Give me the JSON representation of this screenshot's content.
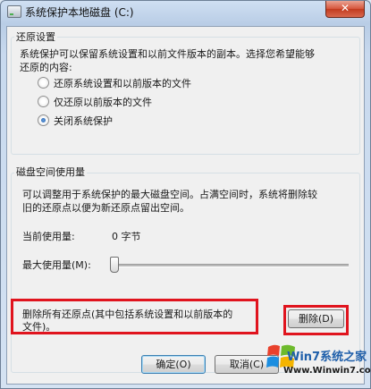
{
  "window": {
    "title": "系统保护本地磁盘 (C:)",
    "close_glyph": "✕"
  },
  "restore_settings": {
    "group_label": "还原设置",
    "description_line1": "系统保护可以保留系统设置和以前文件版本的副本。选择您希望能够",
    "description_line2": "还原的内容:",
    "options": [
      {
        "label": "还原系统设置和以前版本的文件",
        "checked": false
      },
      {
        "label": "仅还原以前版本的文件",
        "checked": false
      },
      {
        "label": "关闭系统保护",
        "checked": true
      }
    ]
  },
  "disk_usage": {
    "group_label": "磁盘空间使用量",
    "description_line1": "可以调整用于系统保护的最大磁盘空间。占满空间时，系统将删除较",
    "description_line2": "旧的还原点以便为新还原点留出空间。",
    "current_usage_label": "当前使用量:",
    "current_usage_value": "0 字节",
    "max_usage_label": "最大使用量(M):",
    "max_usage_fraction": 0
  },
  "delete_section": {
    "text_line1": "删除所有还原点(其中包括系统设置和以前版本的",
    "text_line2": "文件)。",
    "delete_button": "删除(D)"
  },
  "footer": {
    "ok_button": "确定(O)",
    "cancel_button": "取消(C)"
  },
  "watermark": {
    "brand": "Win7系统之家",
    "url": "Www.Winwin7.com"
  },
  "colors": {
    "highlight": "#e0141e",
    "radio_selected": "#1d5fb3"
  }
}
